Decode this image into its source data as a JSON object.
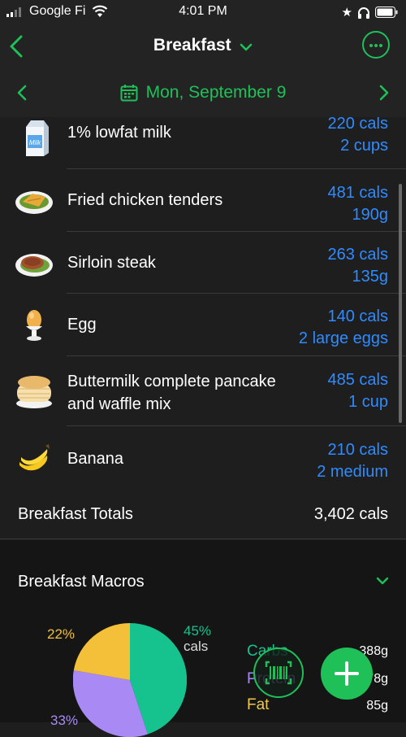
{
  "status_bar": {
    "carrier": "Google Fi",
    "time": "4:01 PM"
  },
  "header": {
    "title": "Breakfast"
  },
  "date_bar": {
    "label": "Mon, September 9"
  },
  "foods": [
    {
      "name": "1% lowfat milk",
      "cals": "220 cals",
      "amount": "2 cups",
      "icon": "milk-carton-icon"
    },
    {
      "name": "Fried chicken tenders",
      "cals": "481 cals",
      "amount": "190g",
      "icon": "chicken-plate-icon"
    },
    {
      "name": "Sirloin steak",
      "cals": "263 cals",
      "amount": "135g",
      "icon": "steak-plate-icon"
    },
    {
      "name": "Egg",
      "cals": "140 cals",
      "amount": "2 large eggs",
      "icon": "egg-cup-icon"
    },
    {
      "name_line1": "Buttermilk complete pancake",
      "name_line2": "and waffle mix",
      "cals": "485 cals",
      "amount": "1 cup",
      "icon": "pancake-stack-icon"
    },
    {
      "name": "Banana",
      "cals": "210 cals",
      "amount": "2 medium",
      "icon": "banana-icon"
    }
  ],
  "totals": {
    "label": "Breakfast Totals",
    "value": "3,402 cals"
  },
  "macros": {
    "title": "Breakfast Macros",
    "carbs_pct": "45%",
    "carbs_unit": "cals",
    "fat_pct": "22%",
    "protein_pct": "33%",
    "legend": {
      "carbs": "Carbs",
      "protein": "Protein",
      "fat": "Fat"
    },
    "grams": {
      "carbs": "388g",
      "protein": "278g",
      "fat": "85g"
    },
    "colors": {
      "carbs": "#16c28e",
      "fat": "#f4c03a",
      "protein": "#a98af5"
    }
  },
  "accent_color": "#1fc058",
  "link_color": "#2f8bff"
}
